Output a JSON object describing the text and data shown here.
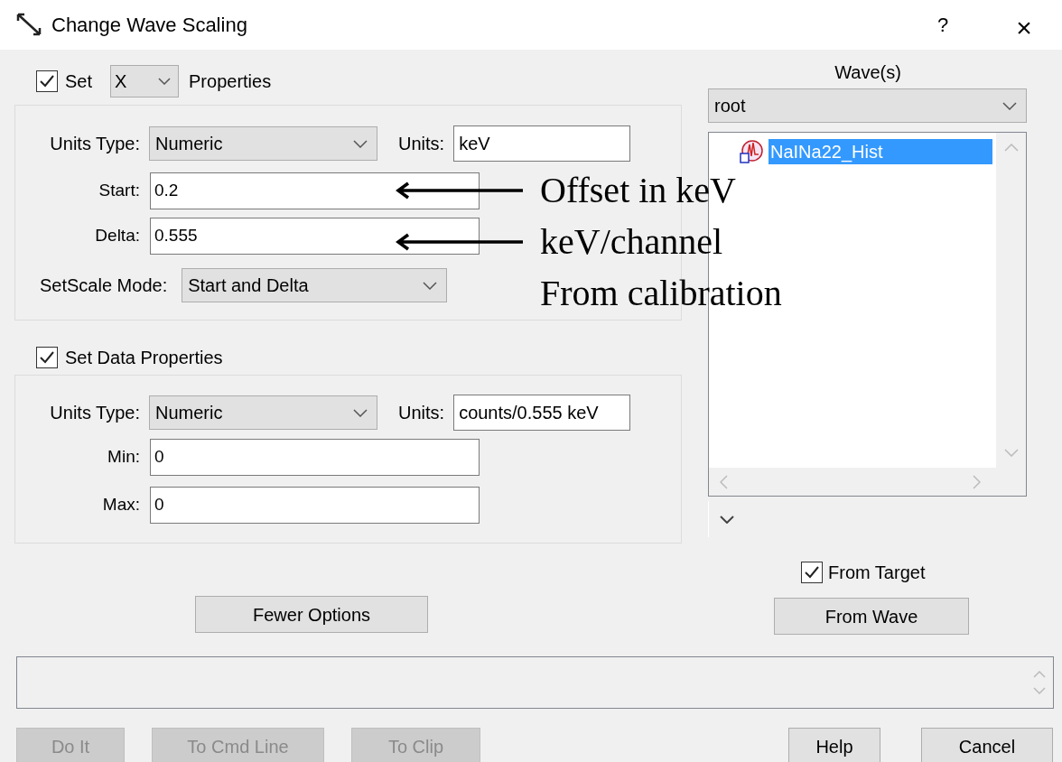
{
  "window": {
    "title": "Change Wave Scaling",
    "help_button": "?",
    "close_button": "×"
  },
  "x_section": {
    "set_checked": true,
    "set_label": "Set",
    "axis": "X",
    "properties_label": "Properties",
    "units_type_label": "Units Type:",
    "units_type": "Numeric",
    "units_label": "Units:",
    "units": "keV",
    "fields": [
      {
        "label": "Start:",
        "value": "0.2"
      },
      {
        "label": "Delta:",
        "value": "0.555"
      }
    ],
    "mode_label": "SetScale Mode:",
    "mode": "Start and Delta"
  },
  "data_section": {
    "checked": true,
    "label": "Set Data Properties",
    "units_type_label": "Units Type:",
    "units_type": "Numeric",
    "units_label": "Units:",
    "units": "counts/0.555 keV",
    "fields": [
      {
        "label": "Min:",
        "value": "0"
      },
      {
        "label": "Max:",
        "value": "0"
      }
    ]
  },
  "waves": {
    "title": "Wave(s)",
    "folder": "root",
    "items": [
      {
        "name": "NaINa22_Hist",
        "selected": true
      }
    ]
  },
  "from_target": {
    "label": "From Target",
    "checked": true
  },
  "fewer_options": "Fewer Options",
  "from_wave": "From Wave",
  "footer_buttons": [
    {
      "label": "Do It",
      "disabled": true
    },
    {
      "label": "To Cmd Line",
      "disabled": true
    },
    {
      "label": "To Clip",
      "disabled": true
    },
    {
      "label": "Help",
      "disabled": false
    },
    {
      "label": "Cancel",
      "disabled": false
    }
  ],
  "annotations": [
    {
      "text": "Offset in keV",
      "arrow": true
    },
    {
      "text": "keV/channel",
      "arrow": true
    },
    {
      "text": "From calibration",
      "arrow": false
    }
  ]
}
